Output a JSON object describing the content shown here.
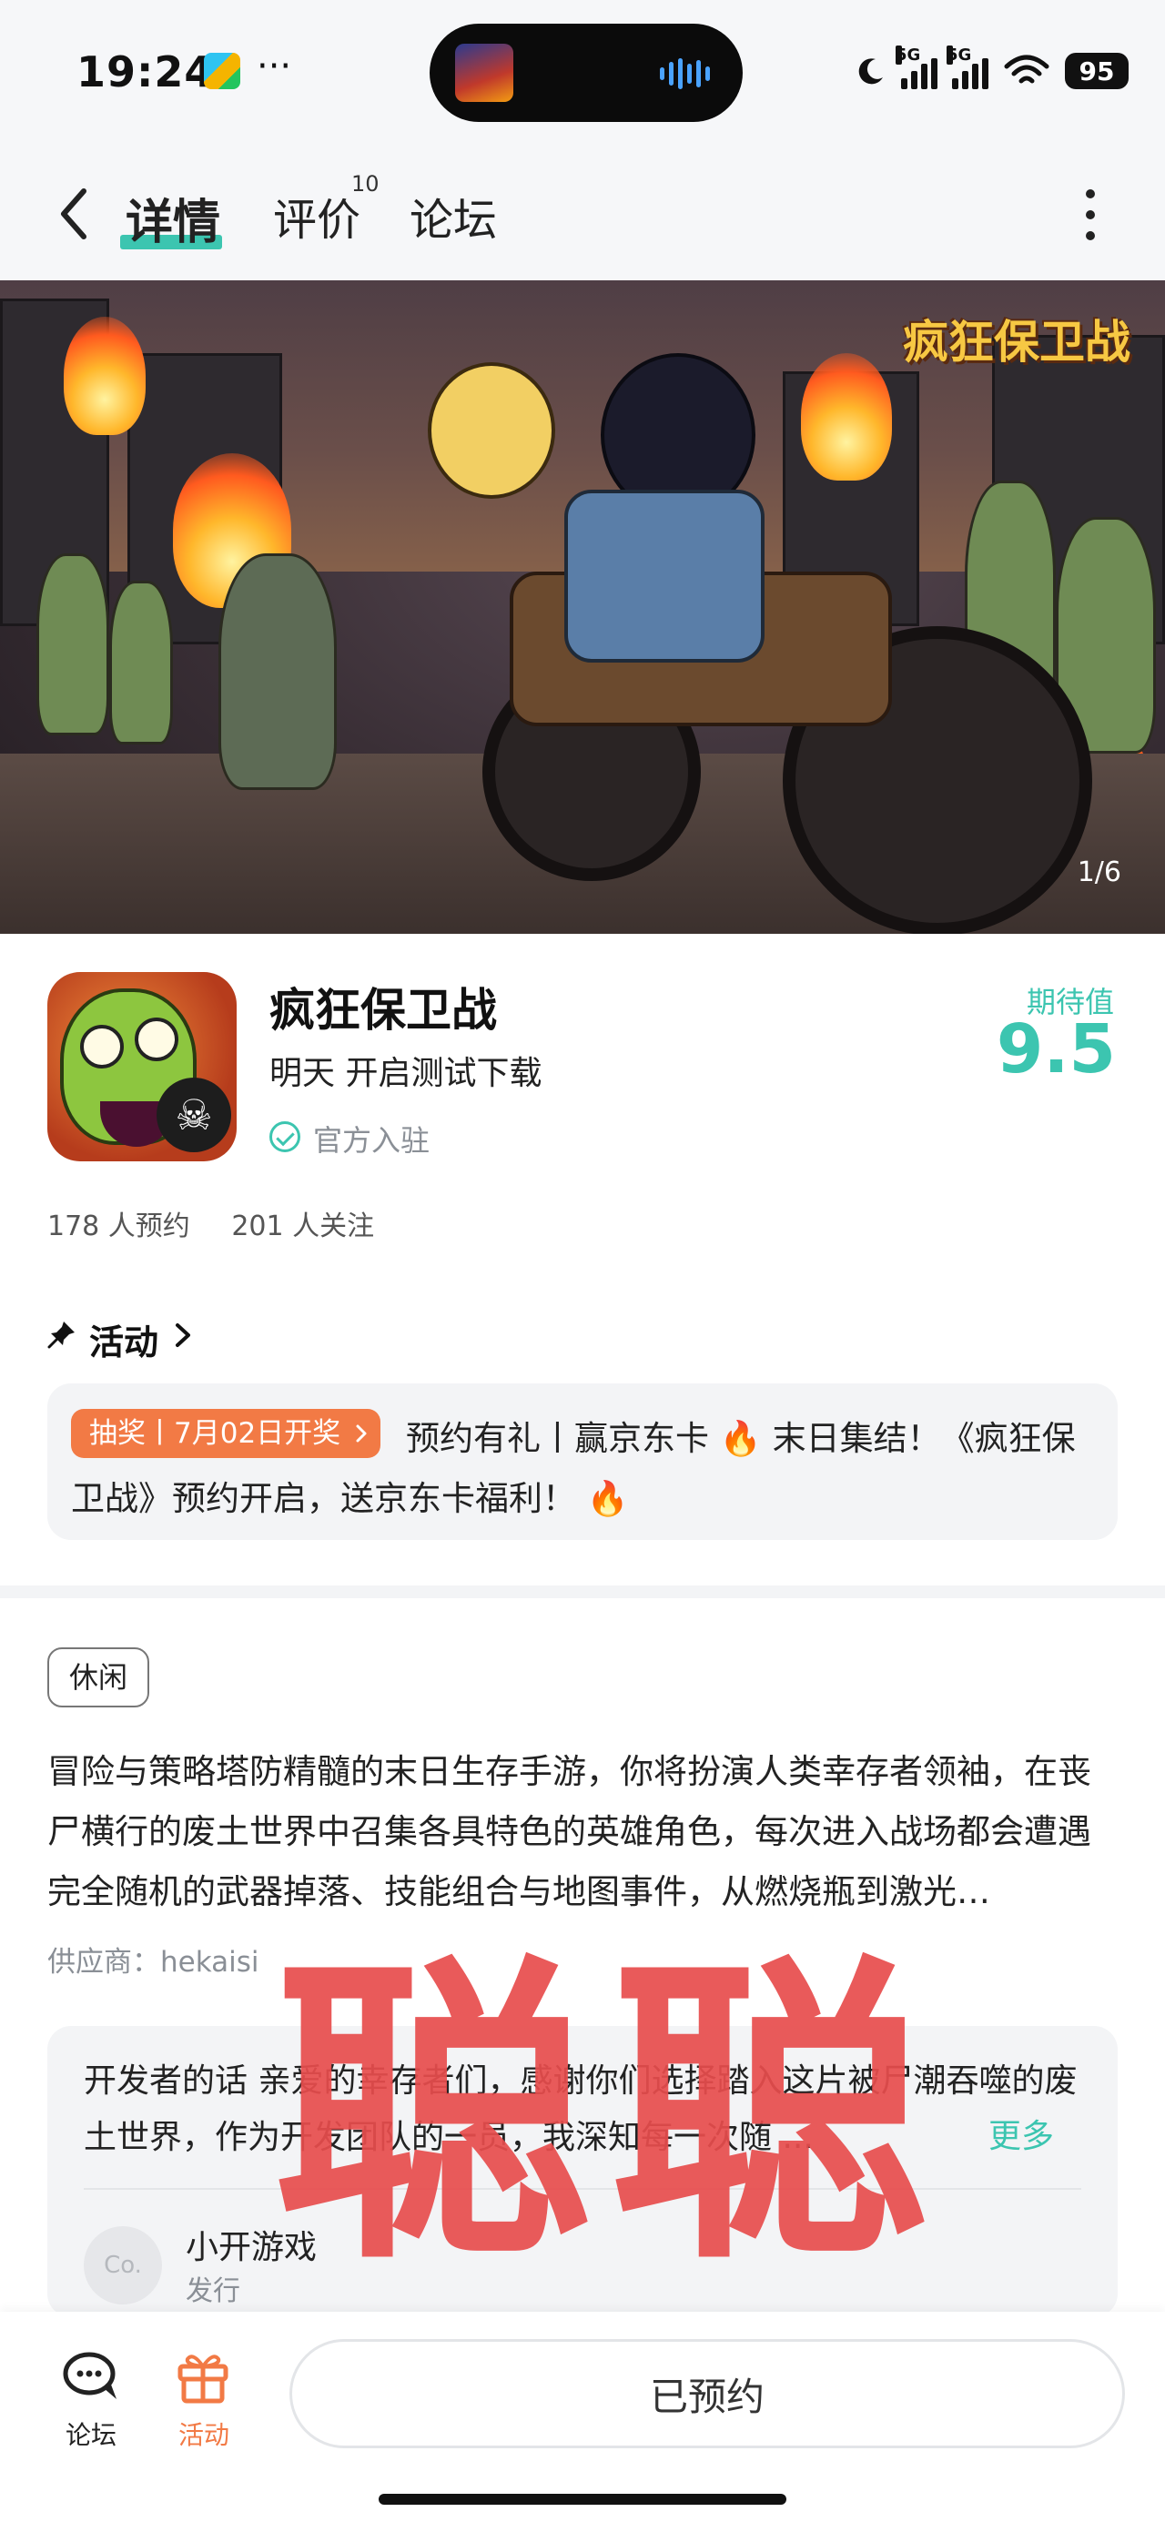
{
  "status_bar": {
    "time": "19:24",
    "dots": "···",
    "signal_1": "5G",
    "signal_2": "5G",
    "battery": "95"
  },
  "header": {
    "tabs": [
      {
        "label": "详情",
        "active": true
      },
      {
        "label": "评价",
        "badge": "10"
      },
      {
        "label": "论坛"
      }
    ]
  },
  "banner": {
    "title": "疯狂保卫战",
    "counter": "1/6"
  },
  "game": {
    "name": "疯狂保卫战",
    "status": "明天 开启测试下载",
    "official": "官方入驻",
    "expect_label": "期待值",
    "expect_score": "9.5",
    "reservations": "178 人预约",
    "followers": "201 人关注"
  },
  "activity": {
    "title": "活动",
    "tag": "抽奖丨7月02日开奖",
    "text": "预约有礼丨赢京东卡 🔥 末日集结！《疯狂保卫战》预约开启，送京东卡福利！ 🔥"
  },
  "details": {
    "genre_tag": "休闲",
    "description": "冒险与策略塔防精髓的末日生存手游，你将扮演人类幸存者领袖，在丧尸横行的废土世界中召集各具特色的英雄角色，每次进入战场都会遭遇完全随机的武器掉落、技能组合与地图事件，从燃烧瓶到激光…",
    "supplier": "供应商：hekaisi",
    "dev_words_lead": "开发者的话",
    "dev_words": "亲爱的幸存者们，感谢你们选择踏入这片被尸潮吞噬的废土世界，作为开发团队的一员，我深知每一次随 ...",
    "more": "更多",
    "dev_avatar": "Co.",
    "dev_name": "小开游戏",
    "dev_role": "发行"
  },
  "watermark": "聪聪",
  "bottom_bar": {
    "forum_label": "论坛",
    "activity_label": "活动",
    "reserve_button": "已预约"
  },
  "colors": {
    "accent": "#3cc5b0",
    "orange": "#f27a45",
    "watermark": "#e84d4d"
  }
}
